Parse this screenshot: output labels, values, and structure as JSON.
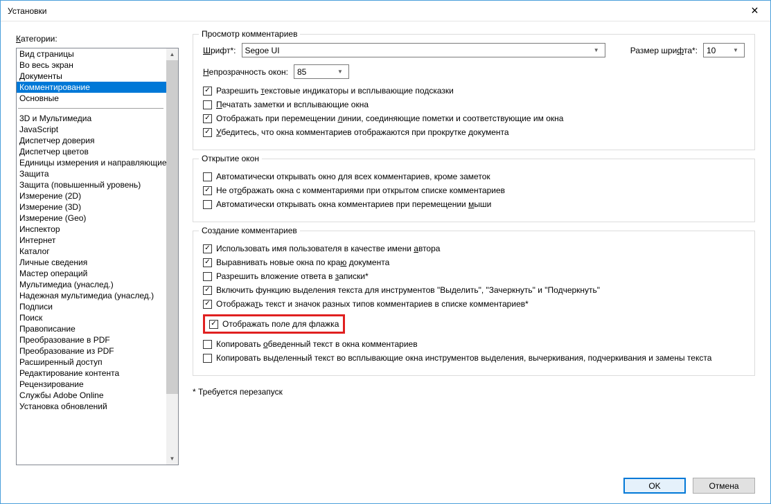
{
  "window": {
    "title": "Установки"
  },
  "sidebar": {
    "label_pre": "К",
    "label_rest": "атегории:",
    "items": [
      {
        "label": "Вид страницы",
        "sel": false
      },
      {
        "label": "Во весь экран",
        "sel": false
      },
      {
        "label": "Документы",
        "sel": false
      },
      {
        "label": "Комментирование",
        "sel": true
      },
      {
        "label": "Основные",
        "sel": false
      },
      {
        "sep": true
      },
      {
        "label": "3D и Мультимедиа",
        "sel": false
      },
      {
        "label": "JavaScript",
        "sel": false
      },
      {
        "label": "Диспетчер доверия",
        "sel": false
      },
      {
        "label": "Диспетчер цветов",
        "sel": false
      },
      {
        "label": "Единицы измерения и направляющие",
        "sel": false
      },
      {
        "label": "Защита",
        "sel": false
      },
      {
        "label": "Защита (повышенный уровень)",
        "sel": false
      },
      {
        "label": "Измерение (2D)",
        "sel": false
      },
      {
        "label": "Измерение (3D)",
        "sel": false
      },
      {
        "label": "Измерение (Geo)",
        "sel": false
      },
      {
        "label": "Инспектор",
        "sel": false
      },
      {
        "label": "Интернет",
        "sel": false
      },
      {
        "label": "Каталог",
        "sel": false
      },
      {
        "label": "Личные сведения",
        "sel": false
      },
      {
        "label": "Мастер операций",
        "sel": false
      },
      {
        "label": "Мультимедиа (унаслед.)",
        "sel": false
      },
      {
        "label": "Надежная мультимедиа (унаслед.)",
        "sel": false
      },
      {
        "label": "Подписи",
        "sel": false
      },
      {
        "label": "Поиск",
        "sel": false
      },
      {
        "label": "Правописание",
        "sel": false
      },
      {
        "label": "Преобразование в PDF",
        "sel": false
      },
      {
        "label": "Преобразование из PDF",
        "sel": false
      },
      {
        "label": "Расширенный доступ",
        "sel": false
      },
      {
        "label": "Редактирование контента",
        "sel": false
      },
      {
        "label": "Рецензирование",
        "sel": false
      },
      {
        "label": "Службы Adobe Online",
        "sel": false
      },
      {
        "label": "Установка обновлений",
        "sel": false
      }
    ]
  },
  "g1": {
    "title": "Просмотр комментариев",
    "font_label_u": "Ш",
    "font_label_rest": "рифт*:",
    "font_value": "Segoe UI",
    "size_label_pre": "Размер шри",
    "size_label_u": "ф",
    "size_label_post": "та*:",
    "size_value": "10",
    "opacity_label_u": "Н",
    "opacity_label_rest": "епрозрачность окон:",
    "opacity_value": "85",
    "cb1": {
      "checked": true,
      "pre": "Разрешить ",
      "u": "т",
      "post": "екстовые индикаторы и всплывающие подсказки"
    },
    "cb2": {
      "checked": false,
      "pre": "",
      "u": "П",
      "post": "ечатать заметки и всплывающие окна"
    },
    "cb3": {
      "checked": true,
      "pre": "Отображать при перемещении ",
      "u": "л",
      "post": "инии, соединяющие пометки и соответствующие им окна"
    },
    "cb4": {
      "checked": true,
      "pre": "",
      "u": "У",
      "post": "бедитесь, что окна комментариев отображаются при прокрутке документа"
    }
  },
  "g2": {
    "title": "Открытие окон",
    "cb1": {
      "checked": false,
      "pre": "Автоматически открывать окно для всех комментариев, кроме заметок"
    },
    "cb2": {
      "checked": true,
      "pre": "Не от",
      "u": "о",
      "post": "бражать окна с комментариями при открытом списке комментариев"
    },
    "cb3": {
      "checked": false,
      "pre": "Автоматически открывать окна комментариев при перемещении ",
      "u": "м",
      "post": "ыши"
    }
  },
  "g3": {
    "title": "Создание комментариев",
    "cb1": {
      "checked": true,
      "pre": "Использовать имя пользователя в качестве имени ",
      "u": "а",
      "post": "втора"
    },
    "cb2": {
      "checked": true,
      "pre": "Выравнивать новые окна по кра",
      "u": "ю",
      "post": " документа"
    },
    "cb3": {
      "checked": false,
      "pre": "Разрешить вложение ответа в ",
      "u": "з",
      "post": "аписки*"
    },
    "cb4": {
      "checked": true,
      "pre": "Включить функцию выделения текста для инструментов \"Выделить\", \"Зачеркнуть\" и \"Подчеркнуть\""
    },
    "cb5": {
      "checked": true,
      "pre": "Отобража",
      "u": "т",
      "post": "ь текст и значок разных типов комментариев в списке комментариев*"
    },
    "cb6": {
      "checked": true,
      "pre": "Отображать поле для флажка"
    },
    "cb7": {
      "checked": false,
      "pre": "Копировать ",
      "u": "о",
      "post": "бведенный текст в окна комментариев"
    },
    "cb8": {
      "checked": false,
      "pre": "Копировать выделенный текст во всплывающие окна инструментов выделения, вычеркивания, подчеркивания и замены текста"
    }
  },
  "footnote": "* Требуется перезапуск",
  "buttons": {
    "ok": "OK",
    "cancel": "Отмена"
  }
}
